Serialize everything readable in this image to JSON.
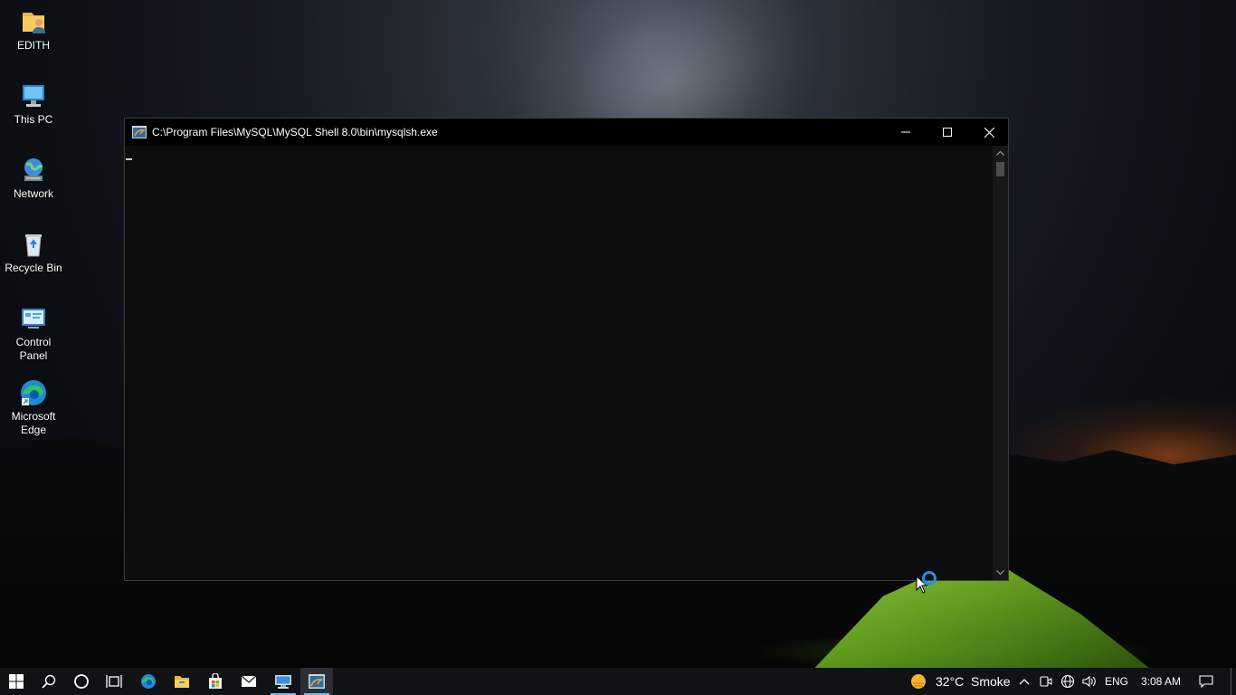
{
  "desktop": {
    "icons": [
      {
        "label": "EDITH"
      },
      {
        "label": "This PC"
      },
      {
        "label": "Network"
      },
      {
        "label": "Recycle Bin"
      },
      {
        "label_line1": "Control",
        "label_line2": "Panel"
      },
      {
        "label_line1": "Microsoft",
        "label_line2": "Edge"
      }
    ]
  },
  "console_window": {
    "title": "C:\\Program Files\\MySQL\\MySQL Shell 8.0\\bin\\mysqlsh.exe",
    "minimize_symbol": "—",
    "close_symbol": "✕",
    "scroll_up": "▲",
    "scroll_down": "▼"
  },
  "taskbar": {
    "icons": [
      "windows-start-icon",
      "search-icon",
      "cortana-icon",
      "task-view-icon",
      "edge-icon",
      "file-explorer-icon",
      "store-icon",
      "mail-icon",
      "remote-desktop-icon",
      "mysql-shell-icon"
    ],
    "weather": {
      "temperature": "32°C",
      "condition": "Smoke"
    },
    "tray_chevron": "^",
    "language": "ENG",
    "time": "3:08 AM"
  },
  "colors": {
    "accent": "#76b9ed",
    "busy_cursor": "#1e8ee8",
    "console_bg": "#0c0c0c"
  }
}
